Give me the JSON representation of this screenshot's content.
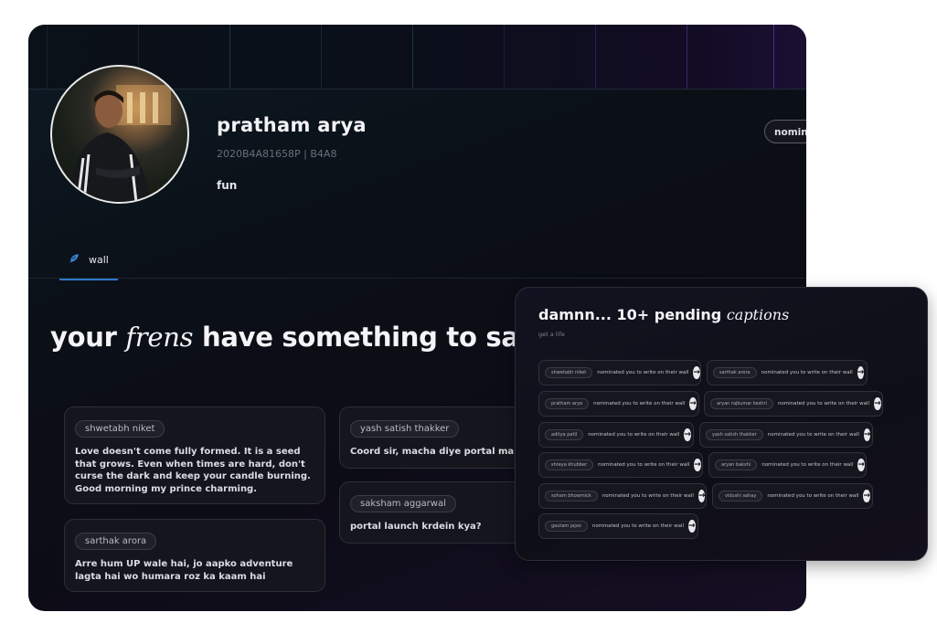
{
  "profile": {
    "name": "pratham arya",
    "id_line": "2020B4A81658P | B4A8",
    "bio": "fun",
    "nominate_label": "nominate"
  },
  "tabs": [
    {
      "label": "wall",
      "icon": "feather-icon"
    }
  ],
  "wall": {
    "heading_pre": "your",
    "heading_em": "frens",
    "heading_post": "have something to say...",
    "posts": [
      {
        "author": "shwetabh niket",
        "text": "Love doesn't come fully formed. It is a seed that grows. Even when times are hard, don't curse the dark and keep your candle burning. Good morning my prince charming."
      },
      {
        "author": "sarthak arora",
        "text": "Arre hum UP wale hai, jo aapko adventure lagta hai wo humara roz ka kaam hai"
      },
      {
        "author": "yash satish thakker",
        "text": "Coord sir, macha diye portal mai toh"
      },
      {
        "author": "saksham aggarwal",
        "text": "portal launch krdein kya?"
      }
    ]
  },
  "pending": {
    "title_pre": "damnn... 10+ pending",
    "title_em": "captions",
    "subtitle": "get a life",
    "action_text": "nominated you to write on their wall",
    "nominations": [
      "shwetabh niket",
      "sarthak arora",
      "pratham arya",
      "aryan rajkumar keshri",
      "aditya patil",
      "yash satish thakker",
      "shreya khubber",
      "aryan bakshi",
      "soham bhowmick",
      "vidushi sahay",
      "gautam jajoo"
    ]
  },
  "colors": {
    "accent": "#2f78c8",
    "background": "#0b1017"
  }
}
